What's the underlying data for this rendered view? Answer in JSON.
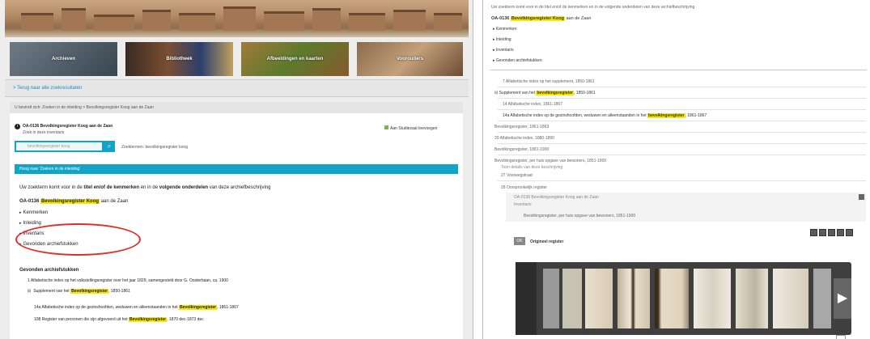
{
  "left": {
    "tiles": [
      {
        "label": "Archieven"
      },
      {
        "label": "Bibliotheek"
      },
      {
        "label": "Afbeeldingen en kaarten"
      },
      {
        "label": "Voorouders"
      }
    ],
    "back_link": "> Terug naar alle zoekresultaten",
    "breadcrumb": "U bevindt zich: Zoeken in de inleiding > Bevolkingsregister Koog aan de Zaan",
    "record_title": "OA-0136 Bevolkingsregister Koog aan de Zaan",
    "record_sub": "Zoek in deze inventaris",
    "add_link": "Aan Studiezaal toevoegen",
    "search_placeholder": "bevolkingsregister koog",
    "search_hint": "Zoektermen: bevolkingsregister koog",
    "cyan_bar": "Hoog naar 'Zoeken in de inleiding'",
    "intro_pre": "Uw zoekterm komt voor in de ",
    "intro_bold1": "titel en/of de kenmerken",
    "intro_mid": " en in de ",
    "intro_bold2": "volgende onderdelen",
    "intro_post": " van deze archiefbeschrijving",
    "heading_code": "OA-0136",
    "heading_hl": "Bevolkingsregister Koog",
    "heading_post": "aan de Zaan",
    "tree": [
      {
        "label": "Kenmerken"
      },
      {
        "label": "Inleiding"
      },
      {
        "label": "Inventaris"
      },
      {
        "label": "Gevonden archiefstukken"
      }
    ],
    "found_heading": "Gevonden archiefstukken",
    "found_item1": "1 Alfabetische index op het volkstellingsregister over het jaar 1829, samengesteld door G. Oosterbaan, ca. 1900",
    "found_item2_pre": "Supplement van het",
    "found_item2_hl": "Bevolkingsregister",
    "found_item2_post": ", 1850-1861",
    "found_item3_pre": "14a Alfabetische index op de gezinshoofden, weduwen en alleenstaanden in het",
    "found_item3_hl": "Bevolkingsregister",
    "found_item3_post": ", 1861-1867",
    "found_item4_pre": "108 Register van personen die zijn afgevoerd uit het",
    "found_item4_hl": "Bevolkingsregister",
    "found_item4_post": ", 1870 dec-1873 dec"
  },
  "right": {
    "top_text": "Uw zoekterm komt voor in de titel en/of de kenmerken en in de volgende onderdelen van deze archiefbeschrijving",
    "heading_code": "OA-0136",
    "heading_hl": "Bevolkingsregister Koog",
    "heading_post": "aan de Zaan",
    "tree": [
      {
        "label": "Kenmerken"
      },
      {
        "label": "Inleiding"
      },
      {
        "label": "Inventaris"
      },
      {
        "label": "Gevonden archiefstukken"
      }
    ],
    "rows": {
      "r1": "7 Alfabetische index op het supplement, 1850-1861",
      "r2_pre": "Supplement van het",
      "r2_hl": "bevolkingsregister",
      "r2_post": ", 1850-1861",
      "r3": "14 Alfabetische index, 1861-1867",
      "r4_pre": "14a Alfabetische index op de gezinshoofden, weduwen en alleenstaanden in het",
      "r4_hl": "bevolkingsregister",
      "r4_post": ", 1861-1867",
      "r5": "Bevolkingsregister, 1861-1863",
      "r6": "20 Alfabetische index, 1880-1890",
      "r7": "Bevolkingsregister, 1881-1900",
      "r8": "Bevolkingsregister, per huis opgave van bewoners, 1851-1900",
      "r9": "Toon details van deze beschrijving",
      "r10": "27 Voorwegstraat",
      "r11": "28 Oorspronkelijk register",
      "r12": "OA-0136 Bevolkingsregister Koog aan de Zaan",
      "r13": "Inventaris",
      "r14": "Bevolkingsregister, per huis opgave van bewoners, 1851-1900",
      "viewer_label": "Origineel register"
    },
    "viewer_btn": "OK"
  }
}
